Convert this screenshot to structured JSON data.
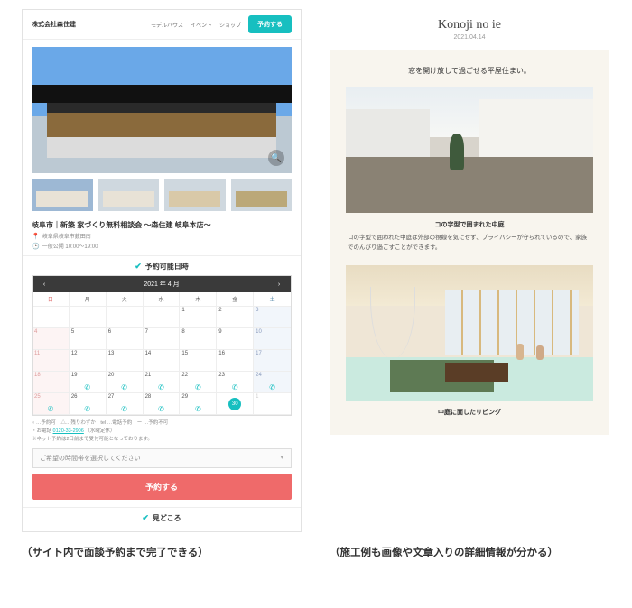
{
  "left": {
    "brand": "株式会社森住建",
    "nav": [
      "モデルハウス",
      "イベント",
      "ショップ"
    ],
    "cta": "予約する",
    "magnify_icon": "�🔍",
    "event_title": "岐阜市｜新築 家づくり無料相談会 ～森住建 岐阜本店～",
    "event_location": "岐阜県岐阜市薮田南",
    "event_time": "一般公開 10:00～19:00",
    "section_available": "予約可能日時",
    "calendar": {
      "month_label": "2021 年 4 月",
      "prev": "‹",
      "next": "›",
      "dow": [
        "日",
        "月",
        "火",
        "水",
        "木",
        "金",
        "土"
      ],
      "rows": [
        [
          {
            "d": ""
          },
          {
            "d": ""
          },
          {
            "d": ""
          },
          {
            "d": ""
          },
          {
            "d": "1"
          },
          {
            "d": "2"
          },
          {
            "d": "3",
            "sat": true
          }
        ],
        [
          {
            "d": "4",
            "sun": true
          },
          {
            "d": "5"
          },
          {
            "d": "6"
          },
          {
            "d": "7"
          },
          {
            "d": "8"
          },
          {
            "d": "9"
          },
          {
            "d": "10",
            "sat": true
          }
        ],
        [
          {
            "d": "11",
            "sun": true
          },
          {
            "d": "12"
          },
          {
            "d": "13"
          },
          {
            "d": "14"
          },
          {
            "d": "15"
          },
          {
            "d": "16"
          },
          {
            "d": "17",
            "sat": true
          }
        ],
        [
          {
            "d": "18",
            "sun": true
          },
          {
            "d": "19",
            "tel": true
          },
          {
            "d": "20",
            "tel": true
          },
          {
            "d": "21",
            "tel": true
          },
          {
            "d": "22",
            "tel": true
          },
          {
            "d": "23",
            "tel": true
          },
          {
            "d": "24",
            "sat": true,
            "tel": true
          }
        ],
        [
          {
            "d": "25",
            "sun": true,
            "tel": true
          },
          {
            "d": "26",
            "tel": true
          },
          {
            "d": "27",
            "tel": true
          },
          {
            "d": "28",
            "tel": true
          },
          {
            "d": "29",
            "tel": true
          },
          {
            "d": "30",
            "today": true
          },
          {
            "d": "1",
            "mute": true
          }
        ]
      ]
    },
    "note_line1_a": "○ …予約可　△…残りわずか　tel …電話予約　ー …予約不可",
    "note_line2_a": "・お電話",
    "note_line2_link": "0120-33-2906",
    "note_line2_b": "（水曜定休）",
    "note_line3": "※ネット予約は2日前まで受付可能となっております。",
    "select_placeholder": "ご希望の時間帯を選択してください",
    "reserve_btn": "予約する",
    "section_highlights": "見どころ"
  },
  "right": {
    "title": "Konoji no ie",
    "date": "2021.04.14",
    "lead": "窓を開け放して過ごせる平屋住まい。",
    "img1_caption": "コの字型で囲まれた中庭",
    "img1_desc": "コの字型で囲われた中庭は外部の視線を気にせず、プライバシーが守られているので、家族でのんびり過ごすことができます。",
    "img2_caption": "中庭に面したリビング"
  },
  "captions": {
    "left": "（サイト内で面談予約まで完了できる）",
    "right": "（施工例も画像や文章入りの詳細情報が分かる）"
  }
}
